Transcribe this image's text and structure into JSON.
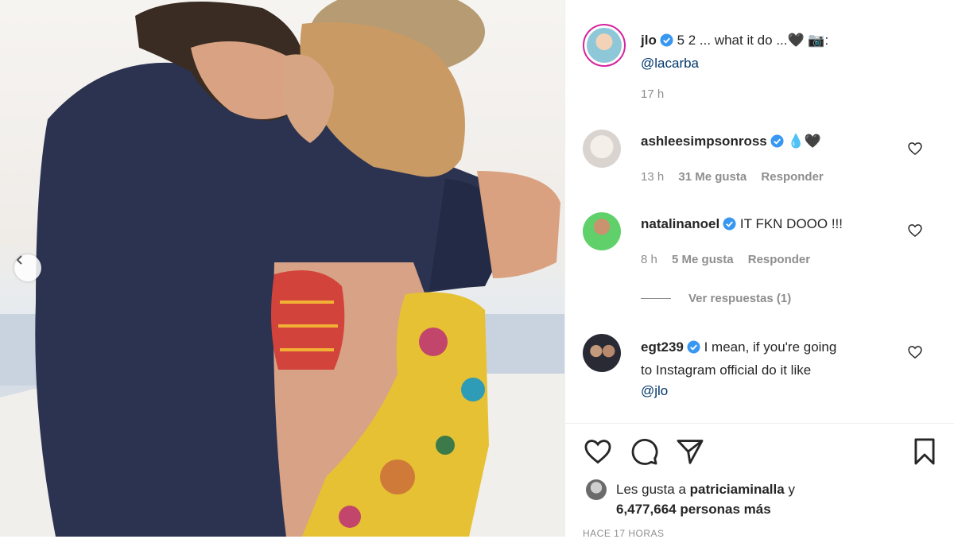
{
  "post": {
    "author": "jlo",
    "caption": "5 2 ... what it do ...🖤 📷:",
    "caption_mention": "@lacarba",
    "time": "17 h"
  },
  "comments": [
    {
      "username": "ashleesimpsonross",
      "text": "💧🖤",
      "time": "13 h",
      "likes": "31 Me gusta",
      "reply": "Responder"
    },
    {
      "username": "natalinanoel",
      "text": "IT FKN DOOO !!!",
      "time": "8 h",
      "likes": "5 Me gusta",
      "reply": "Responder"
    },
    {
      "username": "egt239",
      "text_line1": "I mean, if you're going",
      "text_line2": "to Instagram official do it like",
      "mention": "@jlo"
    }
  ],
  "view_replies": "Ver respuestas (1)",
  "likes": {
    "prefix": "Les gusta a",
    "user": "patriciaminalla",
    "suffix": "y",
    "count": "6,477,664 personas más"
  },
  "timestamp": "HACE 17 HORAS",
  "icons": {
    "like": "heart-outline-icon",
    "comment": "speech-bubble-icon",
    "share": "paper-plane-icon",
    "save": "bookmark-icon",
    "verified": "verified-badge-icon",
    "prev": "chevron-left-icon"
  },
  "colors": {
    "verified": "#3897f0",
    "link": "#00376b",
    "muted": "#8e8e8e",
    "text": "#262626"
  }
}
